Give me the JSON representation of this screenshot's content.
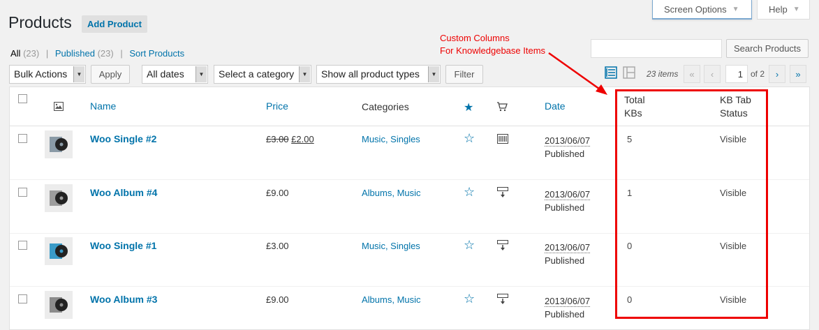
{
  "screen_meta": {
    "screen_options": "Screen Options",
    "help": "Help"
  },
  "page": {
    "title": "Products",
    "add_button": "Add Product"
  },
  "filters": {
    "all": "All",
    "all_count": "(23)",
    "published": "Published",
    "published_count": "(23)",
    "sort": "Sort Products",
    "sep": "|"
  },
  "annotation": {
    "line1": "Custom Columns",
    "line2": "For Knowledgebase Items"
  },
  "search": {
    "button": "Search Products",
    "value": ""
  },
  "tablenav": {
    "bulk_actions": "Bulk Actions",
    "apply": "Apply",
    "dates": "All dates",
    "category": "Select a category",
    "product_types": "Show all product types",
    "filter": "Filter",
    "items": "23 items",
    "first": "«",
    "prev": "‹",
    "page": "1",
    "of": "of 2",
    "next": "›",
    "last": "»"
  },
  "columns": {
    "name": "Name",
    "price": "Price",
    "categories": "Categories",
    "date": "Date",
    "total_kbs_1": "Total",
    "total_kbs_2": "KBs",
    "kb_tab_1": "KB Tab",
    "kb_tab_2": "Status"
  },
  "rows": [
    {
      "name": "Woo Single #2",
      "price_old": "£3.00",
      "price": "£2.00",
      "categories": "Music, Singles",
      "date": "2013/06/07",
      "status": "Published",
      "kbs": "5",
      "kb_status": "Visible",
      "type": "virtual",
      "thumb_color": "#8a9aa6"
    },
    {
      "name": "Woo Album #4",
      "price_old": "",
      "price": "£9.00",
      "categories": "Albums, Music",
      "date": "2013/06/07",
      "status": "Published",
      "kbs": "1",
      "kb_status": "Visible",
      "type": "downloadable",
      "thumb_color": "#9c9c9c"
    },
    {
      "name": "Woo Single #1",
      "price_old": "",
      "price": "£3.00",
      "categories": "Music, Singles",
      "date": "2013/06/07",
      "status": "Published",
      "kbs": "0",
      "kb_status": "Visible",
      "type": "downloadable",
      "thumb_color": "#3a9bc8"
    },
    {
      "name": "Woo Album #3",
      "price_old": "",
      "price": "£9.00",
      "categories": "Albums, Music",
      "date": "2013/06/07",
      "status": "Published",
      "kbs": "0",
      "kb_status": "Visible",
      "type": "downloadable",
      "thumb_color": "#8c8c8c"
    }
  ],
  "colors": {
    "accent": "#0073aa",
    "annotation": "#ee0000"
  }
}
